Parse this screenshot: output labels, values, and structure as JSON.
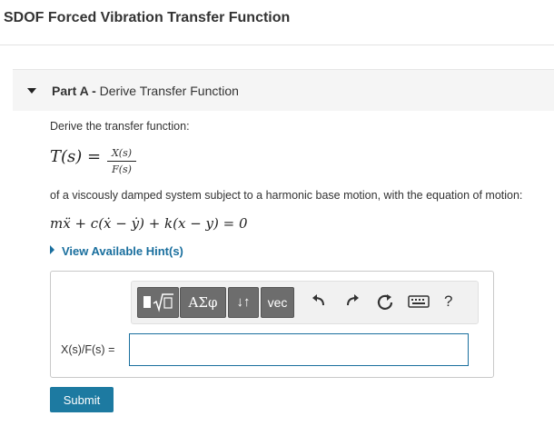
{
  "page": {
    "title": "SDOF Forced Vibration Transfer Function"
  },
  "part": {
    "prefix": "Part A -",
    "name": "Derive Transfer Function"
  },
  "content": {
    "intro": "Derive the transfer function:",
    "transfer_lhs": "T(s) =",
    "transfer_num": "X(s)",
    "transfer_den": "F(s)",
    "desc": "of a viscously damped system subject to a harmonic base motion, with the equation of motion:",
    "equation": "mẍ + c(ẋ − ẏ) + k(x − y) = 0"
  },
  "hint": {
    "label": "View Available Hint(s)"
  },
  "toolbar": {
    "templates_icon": "fraction-sqrt-template-icon",
    "symbols_label": "ΑΣφ",
    "arrows_label": "↓↑",
    "vec_label": "vec",
    "undo_icon": "undo-icon",
    "redo_icon": "redo-icon",
    "reset_icon": "reset-icon",
    "keyboard_icon": "keyboard-icon",
    "help_label": "?"
  },
  "answer": {
    "label": "X(s)/F(s) =",
    "value": ""
  },
  "submit": {
    "label": "Submit"
  },
  "colors": {
    "link": "#1a6f9e",
    "submit": "#1d7aa1",
    "toolbar_button": "#6d6d6d"
  }
}
